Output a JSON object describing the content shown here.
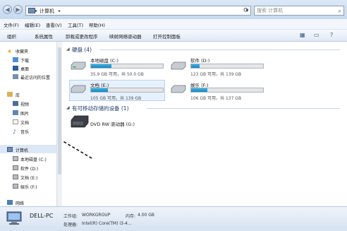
{
  "address": {
    "path": "计算机",
    "search_placeholder": "搜索 计算机"
  },
  "menu": [
    "文件(F)",
    "编辑(E)",
    "查看(V)",
    "工具(T)",
    "帮助(H)"
  ],
  "toolbar": [
    "组织",
    "系统属性",
    "卸载或更改程序",
    "映射网络驱动器",
    "打开控制面板"
  ],
  "sidebar": {
    "favorites": "收藏夹",
    "downloads": "下载",
    "desktop": "桌面",
    "recent": "最近访问的位置",
    "library": "库",
    "videos": "视频",
    "pictures": "图片",
    "documents": "文档",
    "music": "音乐",
    "computer": "计算机",
    "drive_c": "本地磁盘 (C:)",
    "drive_d": "软件 (D:)",
    "drive_e": "文档 (E:)",
    "drive_f": "娱乐 (F:)",
    "network": "网络"
  },
  "content": {
    "hdd_group": "硬盘 (4)",
    "removable_group": "有可移动存储的设备 (1)",
    "drives": [
      {
        "name": "本地磁盘 (C:)",
        "info": "35.9 GB 可用，共 50.0 GB",
        "used_fraction": 0.28
      },
      {
        "name": "软件 (D:)",
        "info": "123 GB 可用，共 139 GB",
        "used_fraction": 0.12
      },
      {
        "name": "文档 (E:)",
        "info": "105 GB 可用，共 139 GB",
        "used_fraction": 0.24
      },
      {
        "name": "娱乐 (F:)",
        "info": "106 GB 可用，共 137 GB",
        "used_fraction": 0.23
      }
    ],
    "dvd": "DVD RW 驱动器 (G:)"
  },
  "details": {
    "pc_name": "DELL-PC",
    "workgroup_label": "工作组:",
    "workgroup": "WORKGROUP",
    "memory_label": "内存:",
    "memory": "4.00 GB",
    "processor_label": "处理器:",
    "processor": "Intel(R) Core(TM) i3-4..."
  },
  "colors": {
    "bar_fill": "#1a86c1",
    "header_text": "#1e3a6e"
  }
}
